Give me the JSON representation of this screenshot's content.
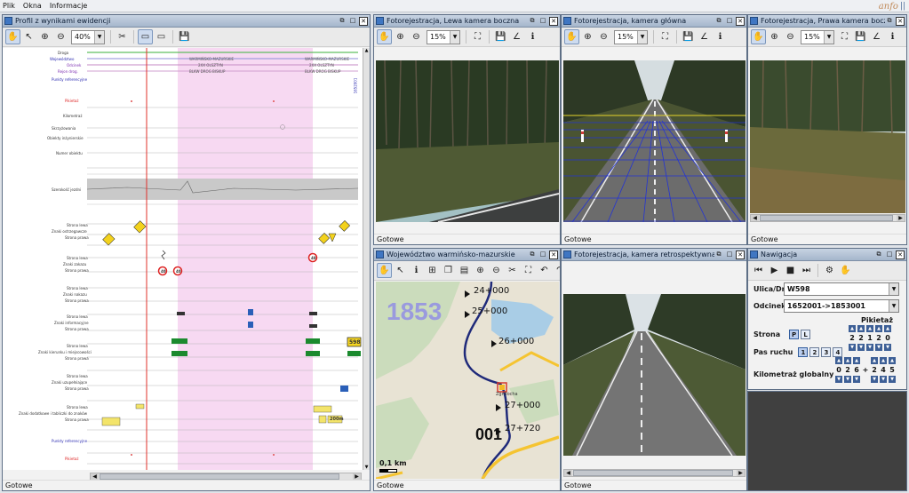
{
  "menu": [
    "Plik",
    "Okna",
    "Informacje"
  ],
  "logo_text": "anfo",
  "profile": {
    "title": "Profil z wynikami ewidencji",
    "zoom": "40%",
    "status": "Gotowe",
    "rows": {
      "droga": "Droga",
      "wojewodztwo": "Województwo",
      "odcinek": "Odcinek",
      "rejon": "Rejon drog.",
      "punkty": "Punkty referencyjne",
      "pikietaz": "Pikietaż",
      "kilometraz": "Kilometraż",
      "skrzyzowania": "Skrzyżowania",
      "obiekty": "Obiekty inżynierskie",
      "numer": "Numer obiektu",
      "szerokosc": "Szerokość jezdni",
      "strona_lewa": "Strona lewa",
      "strona_prawa": "Strona prawa",
      "ostrzegawcze": "Znaki ostrzegawcze",
      "zakazu": "Znaki zakazu",
      "nakazu": "Znaki nakazu",
      "informacyjne": "Znaki informacyjne",
      "kierunku": "Znaki kierunku i miejscowości",
      "uzupelniajace": "Znaki uzupełniające",
      "dodatkowe": "Znaki dodatkowe i tabliczki do znaków"
    },
    "band_labels": {
      "woj": "WARMIŃSKO-MAZURSKIE",
      "odc": "2XX OLSZTYN",
      "rejon": "BLKW DROG BISKUP",
      "road_num": "1652001"
    },
    "sign_labels": {
      "speed1": "40",
      "speed2": "40",
      "speed3": "40",
      "road": "598",
      "dist": "200m"
    }
  },
  "left_cam": {
    "title": "Fotorejestracja, Lewa kamera boczna",
    "zoom": "15%",
    "status": "Gotowe"
  },
  "main_cam": {
    "title": "Fotorejestracja, kamera główna",
    "zoom": "15%",
    "status": "Gotowe"
  },
  "right_cam": {
    "title": "Fotorejestracja, Prawa kamera boczna",
    "zoom": "15%",
    "status": "Gotowe"
  },
  "map": {
    "title": "Województwo warmińsko-mazurskie",
    "status": "Gotowe",
    "road_number": "1853",
    "segment_number": "001",
    "kms": [
      "24+000",
      "25+000",
      "26+000",
      "27+000",
      "27+720"
    ],
    "scale": "0,1 km",
    "town": "Zgniłocha"
  },
  "retro_cam": {
    "title": "Fotorejestracja, kamera retrospektywna",
    "status": "Gotowe"
  },
  "nav": {
    "title": "Nawigacja",
    "road_label": "Ulica/Droga",
    "road_value": "W598",
    "segment_label": "Odcinek",
    "segment_value": "1652001->1853001",
    "pikietaz_label": "Pikietaż",
    "side_label": "Strona",
    "side_options": [
      "P",
      "L"
    ],
    "lane_label": "Pas ruchu",
    "lane_options": [
      "1",
      "2",
      "3",
      "4"
    ],
    "km_label": "Kilometraż globalny",
    "pikietaz_digits": [
      "2",
      "2",
      "1",
      "2",
      "0"
    ],
    "km_digits": [
      "0",
      "2",
      "6",
      "+",
      "2",
      "4",
      "5"
    ]
  }
}
